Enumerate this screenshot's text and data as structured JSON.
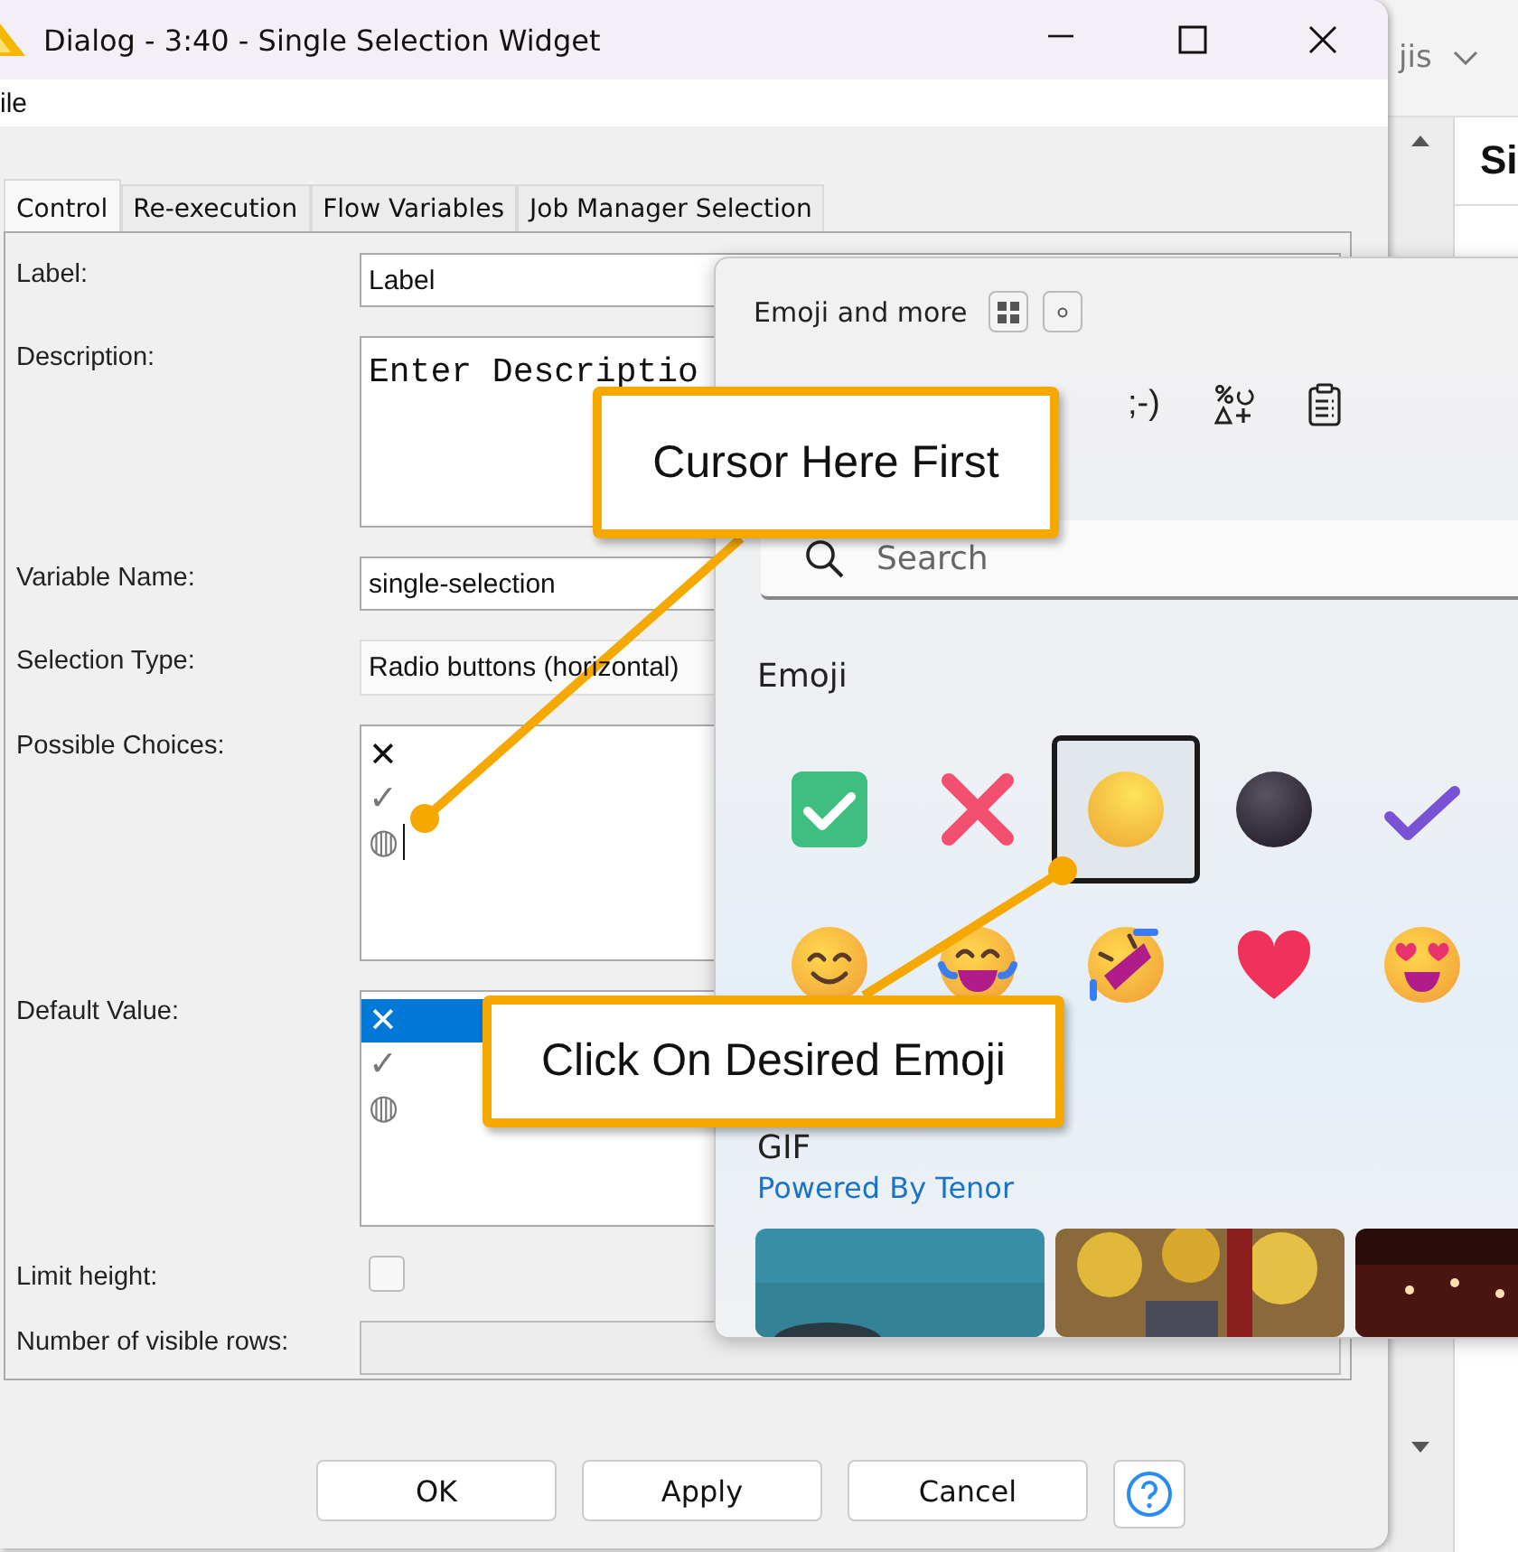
{
  "background_app": {
    "tab_fragment": "jis",
    "header_fragment": "Si"
  },
  "dialog": {
    "title": "Dialog - 3:40 - Single Selection Widget",
    "menu": [
      "ile"
    ],
    "tabs": [
      {
        "label": "Control",
        "selected": true
      },
      {
        "label": "Re-execution",
        "selected": false
      },
      {
        "label": "Flow Variables",
        "selected": false
      },
      {
        "label": "Job Manager Selection",
        "selected": false
      }
    ],
    "fields": [
      {
        "kind": "text",
        "label": "Label:",
        "value": "Label"
      },
      {
        "kind": "textarea",
        "label": "Description:",
        "value": "Enter Descriptio"
      },
      {
        "kind": "text",
        "label": "Variable Name:",
        "value": "single-selection"
      },
      {
        "kind": "combo",
        "label": "Selection Type:",
        "value": "Radio buttons (horizontal)"
      },
      {
        "kind": "list",
        "label": "Possible Choices:",
        "items": [
          {
            "text": "✕",
            "selected": false,
            "caret": false
          },
          {
            "text": "✓",
            "selected": false,
            "caret": false
          },
          {
            "text": "◍",
            "selected": false,
            "caret": true
          }
        ]
      },
      {
        "kind": "list",
        "label": "Default Value:",
        "items": [
          {
            "text": "✕",
            "selected": true,
            "caret": false
          },
          {
            "text": "✓",
            "selected": false,
            "caret": false
          },
          {
            "text": "◍",
            "selected": false,
            "caret": false
          }
        ]
      },
      {
        "kind": "checkbox",
        "label": "Limit height:",
        "checked": false
      },
      {
        "kind": "text",
        "label": "Number of visible rows:",
        "disabled": true
      }
    ],
    "buttons": [
      {
        "kind": "text",
        "label": "OK"
      },
      {
        "kind": "text",
        "label": "Apply"
      },
      {
        "kind": "text",
        "label": "Cancel"
      },
      {
        "kind": "help"
      }
    ]
  },
  "emoji_panel": {
    "title": "Emoji and more",
    "tabs": [
      {
        "kind": "text",
        "label": ";-)"
      },
      {
        "kind": "symbols"
      },
      {
        "kind": "clipboard"
      }
    ],
    "search": {
      "placeholder": "Search"
    },
    "section": "Emoji",
    "emojis": [
      {
        "kind": "check_button",
        "selected": false
      },
      {
        "kind": "cross",
        "selected": false
      },
      {
        "kind": "yellow_circle",
        "selected": true
      },
      {
        "kind": "black_circle",
        "selected": false
      },
      {
        "kind": "check",
        "selected": false
      },
      {
        "kind": "smiling",
        "selected": false
      },
      {
        "kind": "tears_of_joy",
        "selected": false
      },
      {
        "kind": "rolling",
        "selected": false
      },
      {
        "kind": "heart",
        "selected": false
      },
      {
        "kind": "heart_eyes",
        "selected": false
      }
    ],
    "gif_heading": "GIF",
    "gif_link": "Powered By Tenor"
  },
  "callouts": [
    {
      "text": "Cursor Here First"
    },
    {
      "text": "Click On Desired Emoji"
    }
  ]
}
